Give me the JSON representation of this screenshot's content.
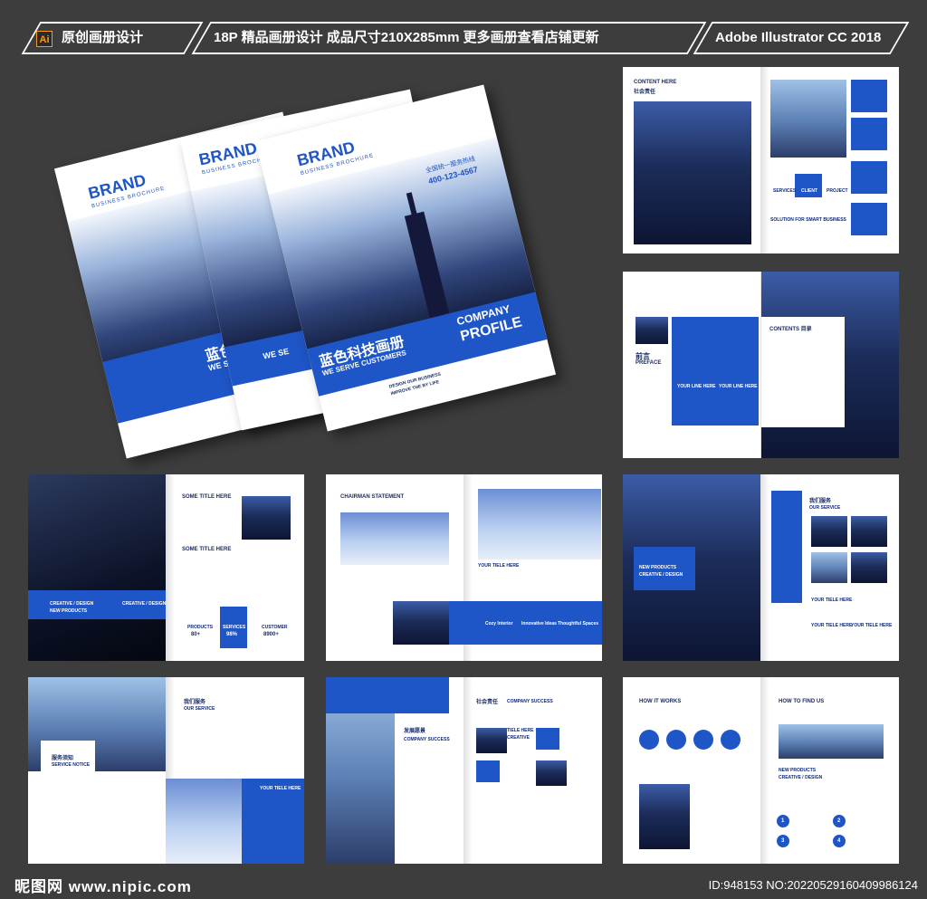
{
  "header": {
    "badge": "Ai",
    "segment1": "原创画册设计",
    "segment2": "18P 精品画册设计 成品尺寸210X285mm 更多画册查看店铺更新",
    "segment3": "Adobe Illustrator CC 2018"
  },
  "covers": {
    "brand": "BRAND",
    "brand_sub": "BUSINESS BROCHURE",
    "hotline_label": "全国统一服务热线",
    "phone": "400-123-4567",
    "cn_title": "蓝色科技画册",
    "cn_title_short": "蓝色",
    "slogan": "WE SERVE CUSTOMERS",
    "slogan_short": "WE SE",
    "company": "COMPANY",
    "profile": "PROFILE",
    "tagline1": "DESIGN OUR BUSINESS",
    "tagline2": "IMPROVE THE BY LIFE"
  },
  "spreads": {
    "s1": {
      "title": "CONTENT HERE",
      "subtitle": "社会责任",
      "services": "SERVICES",
      "client": "CLIENT",
      "project": "PROJECT",
      "solution": "SOLUTION FOR SMART BUSINESS"
    },
    "s2": {
      "cn": "前言",
      "title": "PREFACE",
      "contents": "CONTENTS 目录",
      "link1": "YOUR LINE HERE",
      "link2": "YOUR LINE HERE"
    },
    "s3": {
      "title1": "SOME TITLE HERE",
      "title2": "SOME TITLE HERE",
      "banner1": "CREATIVE / DESIGN",
      "banner2": "NEW PRODUCTS",
      "banner3": "CREATIVE / DESIGN",
      "products": "PRODUCTS",
      "products_val": "80+",
      "services": "SERVICES",
      "services_val": "98%",
      "customer": "CUSTOMER",
      "customer_val": "8900+"
    },
    "s4": {
      "title": "CHAIRMAN STATEMENT",
      "tiele": "YOUR TIELE HERE",
      "icon1": "Cozy Interior",
      "icon2": "Innovative Ideas",
      "icon3": "Thoughtful Spaces"
    },
    "s5": {
      "cn": "我们服务",
      "title": "OUR SERVICE",
      "banner1": "NEW PRODUCTS",
      "banner2": "CREATIVE / DESIGN",
      "tiele1": "YOUR TIELE HERE",
      "tiele2": "YOUR TIELE HERE",
      "tiele3": "YOUR TIELE HERE"
    },
    "s6": {
      "cn1": "我们服务",
      "title": "OUR SERVICE",
      "cn2": "服务须知",
      "notice": "SERVICE NOTICE",
      "tiele": "YOUR TIELE HERE"
    },
    "s7": {
      "cn1": "发展愿景",
      "title": "COMPANY SUCCESS",
      "cn2": "社会责任",
      "title2": "COMPANY SUCCESS",
      "tiele": "TIELE HERE",
      "creative": "CREATIVE"
    },
    "s8": {
      "how": "HOW IT WORKS",
      "find": "HOW TO FIND US",
      "np": "NEW PRODUCTS",
      "cd": "CREATIVE / DESIGN",
      "n1": "1",
      "n2": "2",
      "n3": "3",
      "n4": "4"
    }
  },
  "footer": {
    "logo": "昵图网 www.nipic.com",
    "id": "ID:948153 NO:20220529160409986124"
  }
}
